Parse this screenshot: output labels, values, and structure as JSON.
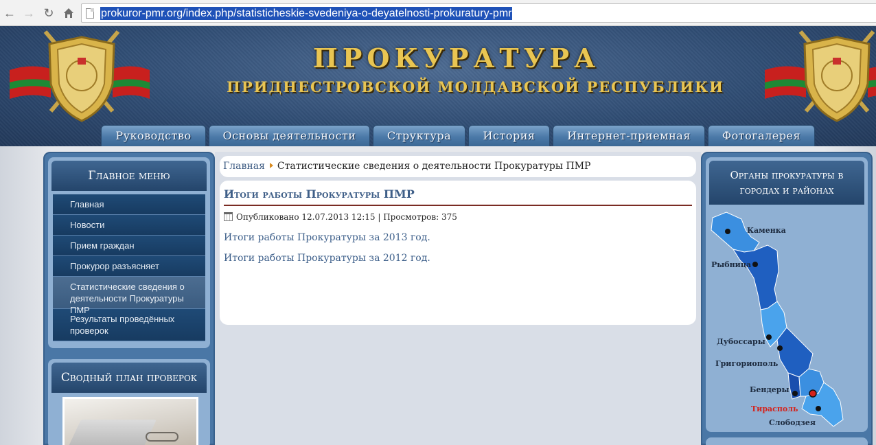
{
  "browser": {
    "url": "prokuror-pmr.org/index.php/statisticheskie-svedeniya-o-deyatelnosti-prokuratury-pmr"
  },
  "header": {
    "title": "ПРОКУРАТУРА",
    "subtitle": "ПРИДНЕСТРОВСКОЙ МОЛДАВСКОЙ РЕСПУБЛИКИ",
    "nav": [
      "Руководство",
      "Основы деятельности",
      "Структура",
      "История",
      "Интернет-приемная",
      "Фотогалерея"
    ]
  },
  "main_menu": {
    "title": "Главное меню",
    "items": [
      "Главная",
      "Новости",
      "Прием граждан",
      "Прокурор разъясняет",
      "Статистические сведения о деятельности Прокуратуры ПМР",
      "Результаты проведённых проверок"
    ],
    "active_index": 4
  },
  "plan_module": {
    "title": "Сводный план проверок"
  },
  "breadcrumb": {
    "home": "Главная",
    "current": "Статистические сведения о деятельности Прокуратуры ПМР"
  },
  "article": {
    "title": "Итоги работы Прокуратуры ПМР",
    "meta": "Опубликовано 12.07.2013 12:15 | Просмотров: 375",
    "links": [
      "Итоги работы Прокуратуры за 2013 год.",
      "Итоги работы Прокуратуры за 2012 год."
    ]
  },
  "map_module": {
    "title": "Органы прокуратуры в городах и районах",
    "cities": [
      "Каменка",
      "Рыбница",
      "Дубоссары",
      "Григориополь",
      "Бендеры",
      "Тирасполь",
      "Слободзея"
    ]
  },
  "colors": {
    "header_bg": "#2f4c73",
    "title_gold": "#e9c552",
    "nav_tab": "#4b79a8",
    "menu_bg": "#1f4a76",
    "link": "#3d5f8a",
    "accent_red": "#d4231c"
  },
  "icons": [
    "back-icon",
    "forward-icon",
    "reload-icon",
    "home-icon",
    "page-icon",
    "calendar-icon"
  ]
}
